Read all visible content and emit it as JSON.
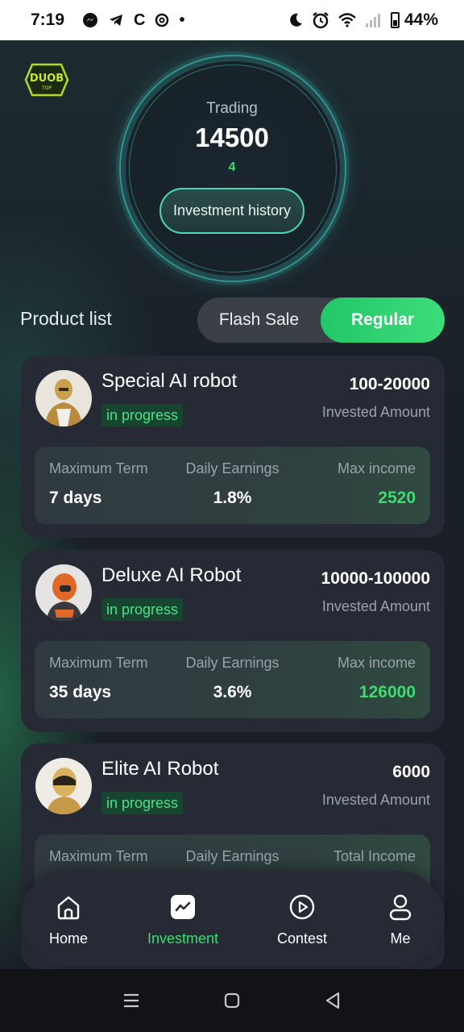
{
  "status_bar": {
    "time": "7:19",
    "battery": "44%",
    "notification_icons": [
      "messenger-icon",
      "telegram-icon",
      "c-icon",
      "threads-icon",
      "dot-icon"
    ],
    "right_icons": [
      "moon-icon",
      "alarm-icon",
      "wifi-icon",
      "signal-icon",
      "battery-icon"
    ]
  },
  "header": {
    "logo_text": "DUOB",
    "logo_sub": "TOP",
    "trading_label": "Trading",
    "trading_value": "14500",
    "trading_count": "4",
    "history_button": "Investment history"
  },
  "product_list": {
    "title": "Product list",
    "tabs": [
      {
        "label": "Flash Sale",
        "active": false
      },
      {
        "label": "Regular",
        "active": true
      }
    ]
  },
  "products": [
    {
      "name": "Special AI robot",
      "status": "in progress",
      "amount": "100-20000",
      "amount_label": "Invested Amount",
      "stats": [
        {
          "label": "Maximum Term",
          "value": "7 days"
        },
        {
          "label": "Daily Earnings",
          "value": "1.8%"
        },
        {
          "label": "Max income",
          "value": "2520"
        }
      ]
    },
    {
      "name": "Deluxe AI Robot",
      "status": "in progress",
      "amount": "10000-100000",
      "amount_label": "Invested Amount",
      "stats": [
        {
          "label": "Maximum Term",
          "value": "35 days"
        },
        {
          "label": "Daily Earnings",
          "value": "3.6%"
        },
        {
          "label": "Max income",
          "value": "126000"
        }
      ]
    },
    {
      "name": "Elite AI Robot",
      "status": "in progress",
      "amount": "6000",
      "amount_label": "Invested Amount",
      "stats": [
        {
          "label": "Maximum Term",
          "value": ""
        },
        {
          "label": "Daily Earnings",
          "value": ""
        },
        {
          "label": "Total Income",
          "value": ""
        }
      ]
    }
  ],
  "bottom_nav": [
    {
      "label": "Home",
      "icon": "home-icon",
      "active": false
    },
    {
      "label": "Investment",
      "icon": "chart-icon",
      "active": true
    },
    {
      "label": "Contest",
      "icon": "play-icon",
      "active": false
    },
    {
      "label": "Me",
      "icon": "user-icon",
      "active": false
    }
  ],
  "colors": {
    "accent_green": "#3ddc6e",
    "background": "#1a1d26",
    "card": "#262a35",
    "ring": "#3cc8be"
  }
}
